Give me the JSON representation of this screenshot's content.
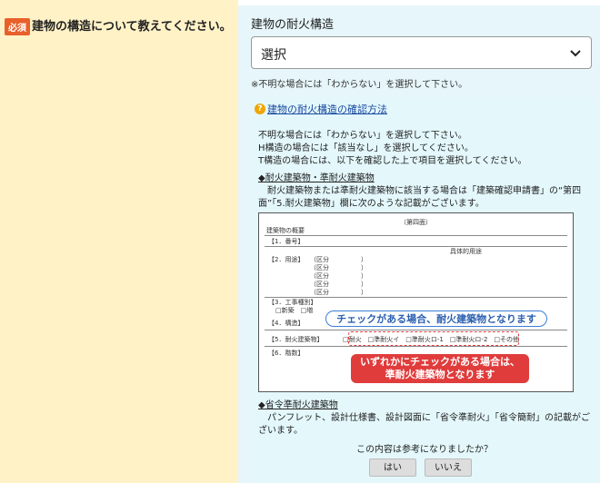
{
  "question": {
    "badge": "必須",
    "title": "建物の構造について教えてください。"
  },
  "field": {
    "label": "建物の耐火構造",
    "selected": "選択",
    "note": "※不明な場合には「わからない」を選択して下さい。"
  },
  "help": {
    "link": "建物の耐火構造の確認方法",
    "lines": [
      "不明な場合には「わからない」を選択して下さい。",
      "H構造の場合には「該当なし」を選択してください。",
      "T構造の場合には、以下を確認した上で項目を選択してください。"
    ],
    "section1_title": "◆耐火建築物・準耐火建築物",
    "section1_lines": [
      "　耐火建築物または準耐火建築物に該当する場合は「建築確認申請書」の“第四",
      "面”「5.耐火建築物」欄に次のような記載がございます。"
    ],
    "document": {
      "header": "（第四面）",
      "title": "建築物の概要",
      "row1": "【1．番号】",
      "col_right": "具体的用途",
      "row2": "【2．用途】",
      "kubun": [
        "（区分　　　　　）",
        "（区分　　　　　）",
        "（区分　　　　　）",
        "（区分　　　　　）",
        "（区分　　　　　）"
      ],
      "row3": "【3．工事種別】",
      "row3_opts": "□新築　□増",
      "row4": "【4．構造】",
      "row5": "【5．耐火建築物】",
      "row5_opts": "□耐火　□準耐火イ　□準耐火ロ-1　□準耐火ロ-2　□その他",
      "row6": "【6．階数】"
    },
    "callout_blue": "チェックがある場合、耐火建築物となります",
    "callout_red": [
      "いずれかにチェックがある場合は、",
      "準耐火建築物となります"
    ],
    "section2_title": "◆省令準耐火建築物",
    "section2_lines": [
      "　パンフレット、設計仕様書、設計図面に「省令準耐火」「省令簡耐」の記載がご",
      "ざいます。"
    ],
    "feedback_q": "この内容は参考になりましたか？",
    "yes": "はい",
    "no": "いいえ"
  }
}
